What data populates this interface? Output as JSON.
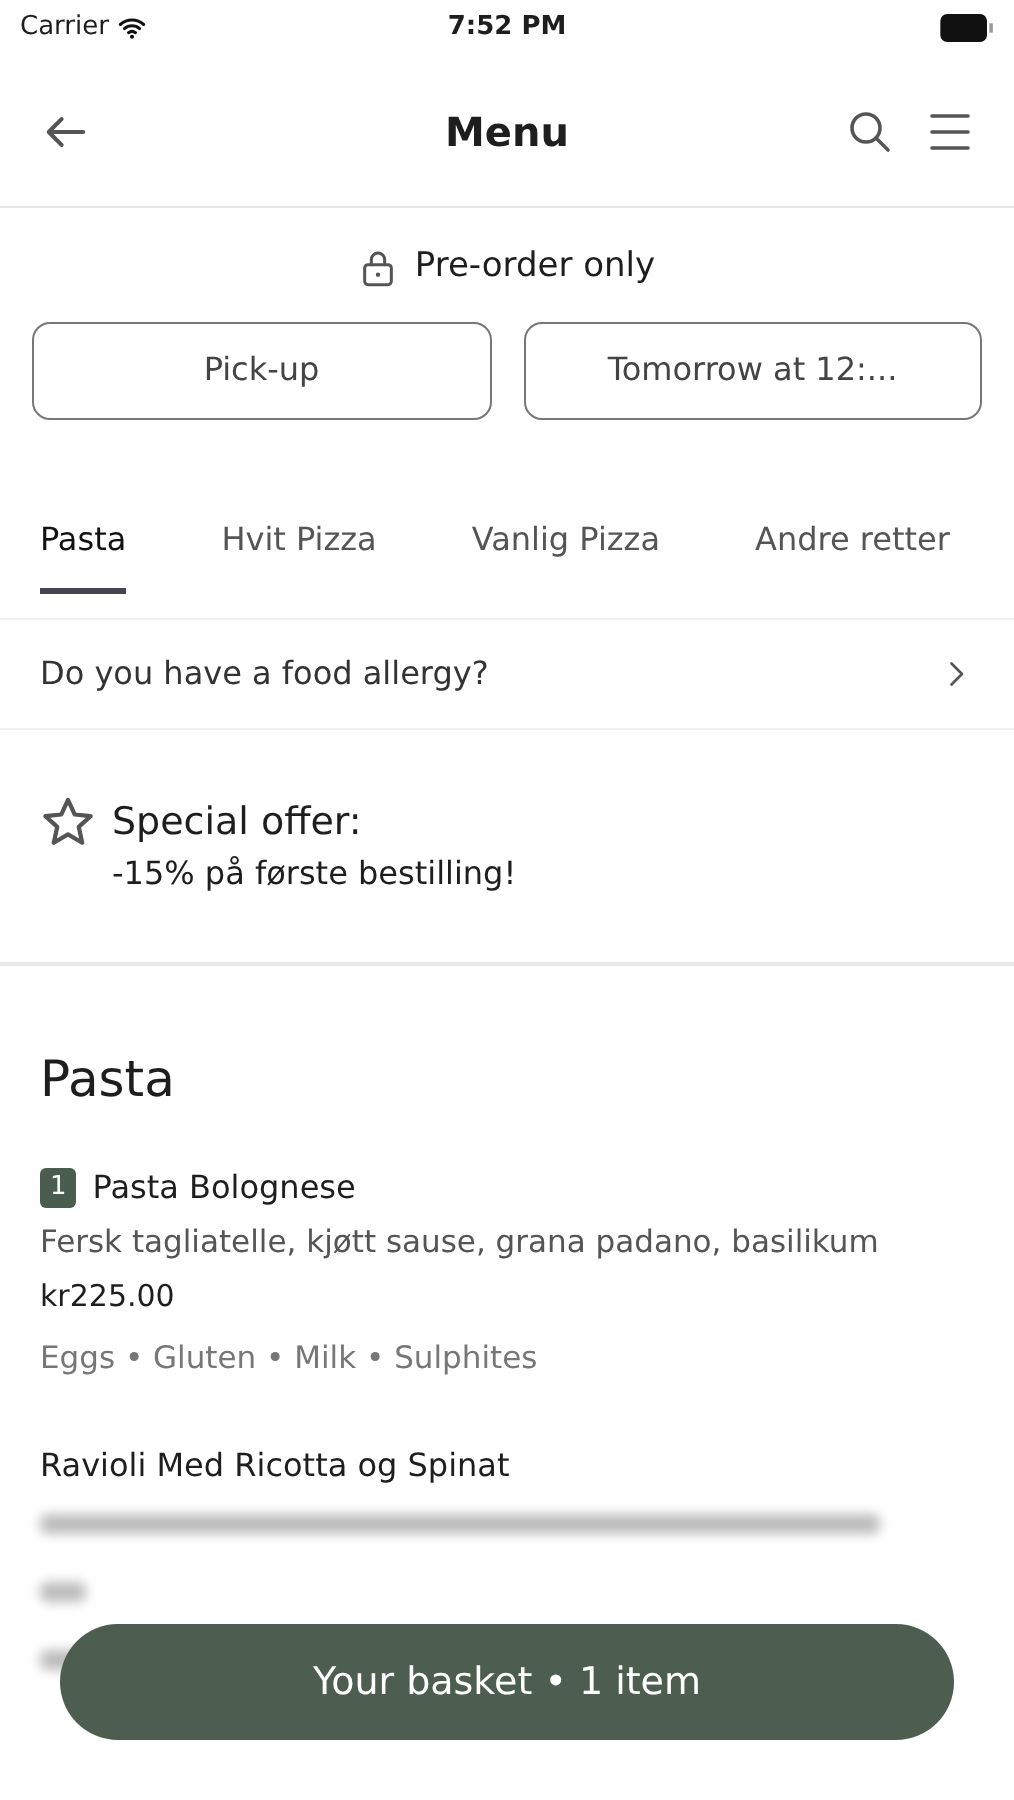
{
  "status_bar": {
    "carrier": "Carrier",
    "time": "7:52 PM"
  },
  "header": {
    "title": "Menu"
  },
  "notice": {
    "text": "Pre-order only"
  },
  "order_options": [
    {
      "label": "Pick-up"
    },
    {
      "label": "Tomorrow at 12:..."
    }
  ],
  "tabs": [
    {
      "label": "Pasta",
      "selected": true
    },
    {
      "label": "Hvit Pizza",
      "selected": false
    },
    {
      "label": "Vanlig Pizza",
      "selected": false
    },
    {
      "label": "Andre retter",
      "selected": false
    }
  ],
  "allergy_row": {
    "text": "Do you have a food allergy?"
  },
  "offer": {
    "title": "Special offer:",
    "text": "-15% på første bestilling!"
  },
  "section": {
    "title": "Pasta",
    "items": [
      {
        "count": "1",
        "name": "Pasta Bolognese",
        "description": "Fersk tagliatelle, kjøtt sause, grana padano, basilikum",
        "price": "kr225.00",
        "allergens": "Eggs • Gluten • Milk • Sulphites",
        "blurred": false
      },
      {
        "name": "Ravioli Med Ricotta og Spinat",
        "blurred": true
      }
    ]
  },
  "basket_button": {
    "label": "Your basket • 1 item"
  }
}
